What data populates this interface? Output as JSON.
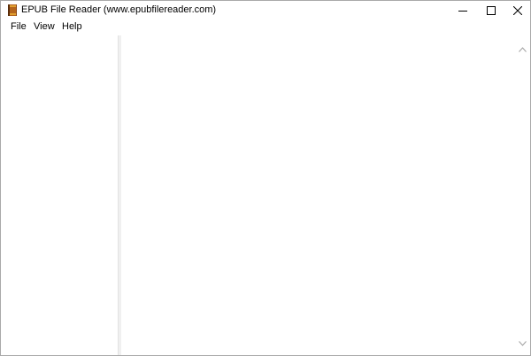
{
  "window": {
    "title": "EPUB File Reader (www.epubfilereader.com)",
    "icon": "book-icon"
  },
  "caption_buttons": {
    "minimize": "minimize-icon",
    "maximize": "maximize-icon",
    "close": "close-icon"
  },
  "menu": {
    "items": [
      {
        "label": "File"
      },
      {
        "label": "View"
      },
      {
        "label": "Help"
      }
    ]
  },
  "scrollbar": {
    "up_icon": "chevron-up-icon",
    "down_icon": "chevron-down-icon"
  },
  "colors": {
    "background": "#ffffff",
    "splitter": "#f0f0f0",
    "window_border": "#a9a9a9",
    "book_icon_brown": "#8b4513",
    "book_icon_gold": "#e0a030"
  }
}
